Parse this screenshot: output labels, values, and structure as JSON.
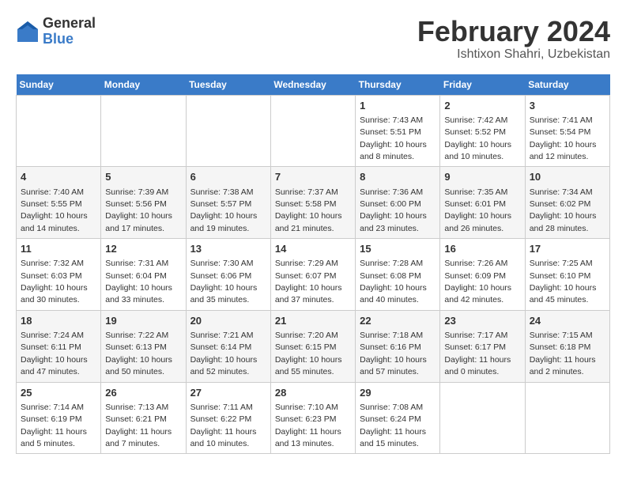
{
  "logo": {
    "general": "General",
    "blue": "Blue"
  },
  "header": {
    "title": "February 2024",
    "subtitle": "Ishtixon Shahri, Uzbekistan"
  },
  "weekdays": [
    "Sunday",
    "Monday",
    "Tuesday",
    "Wednesday",
    "Thursday",
    "Friday",
    "Saturday"
  ],
  "weeks": [
    [
      {
        "day": "",
        "detail": ""
      },
      {
        "day": "",
        "detail": ""
      },
      {
        "day": "",
        "detail": ""
      },
      {
        "day": "",
        "detail": ""
      },
      {
        "day": "1",
        "detail": "Sunrise: 7:43 AM\nSunset: 5:51 PM\nDaylight: 10 hours\nand 8 minutes."
      },
      {
        "day": "2",
        "detail": "Sunrise: 7:42 AM\nSunset: 5:52 PM\nDaylight: 10 hours\nand 10 minutes."
      },
      {
        "day": "3",
        "detail": "Sunrise: 7:41 AM\nSunset: 5:54 PM\nDaylight: 10 hours\nand 12 minutes."
      }
    ],
    [
      {
        "day": "4",
        "detail": "Sunrise: 7:40 AM\nSunset: 5:55 PM\nDaylight: 10 hours\nand 14 minutes."
      },
      {
        "day": "5",
        "detail": "Sunrise: 7:39 AM\nSunset: 5:56 PM\nDaylight: 10 hours\nand 17 minutes."
      },
      {
        "day": "6",
        "detail": "Sunrise: 7:38 AM\nSunset: 5:57 PM\nDaylight: 10 hours\nand 19 minutes."
      },
      {
        "day": "7",
        "detail": "Sunrise: 7:37 AM\nSunset: 5:58 PM\nDaylight: 10 hours\nand 21 minutes."
      },
      {
        "day": "8",
        "detail": "Sunrise: 7:36 AM\nSunset: 6:00 PM\nDaylight: 10 hours\nand 23 minutes."
      },
      {
        "day": "9",
        "detail": "Sunrise: 7:35 AM\nSunset: 6:01 PM\nDaylight: 10 hours\nand 26 minutes."
      },
      {
        "day": "10",
        "detail": "Sunrise: 7:34 AM\nSunset: 6:02 PM\nDaylight: 10 hours\nand 28 minutes."
      }
    ],
    [
      {
        "day": "11",
        "detail": "Sunrise: 7:32 AM\nSunset: 6:03 PM\nDaylight: 10 hours\nand 30 minutes."
      },
      {
        "day": "12",
        "detail": "Sunrise: 7:31 AM\nSunset: 6:04 PM\nDaylight: 10 hours\nand 33 minutes."
      },
      {
        "day": "13",
        "detail": "Sunrise: 7:30 AM\nSunset: 6:06 PM\nDaylight: 10 hours\nand 35 minutes."
      },
      {
        "day": "14",
        "detail": "Sunrise: 7:29 AM\nSunset: 6:07 PM\nDaylight: 10 hours\nand 37 minutes."
      },
      {
        "day": "15",
        "detail": "Sunrise: 7:28 AM\nSunset: 6:08 PM\nDaylight: 10 hours\nand 40 minutes."
      },
      {
        "day": "16",
        "detail": "Sunrise: 7:26 AM\nSunset: 6:09 PM\nDaylight: 10 hours\nand 42 minutes."
      },
      {
        "day": "17",
        "detail": "Sunrise: 7:25 AM\nSunset: 6:10 PM\nDaylight: 10 hours\nand 45 minutes."
      }
    ],
    [
      {
        "day": "18",
        "detail": "Sunrise: 7:24 AM\nSunset: 6:11 PM\nDaylight: 10 hours\nand 47 minutes."
      },
      {
        "day": "19",
        "detail": "Sunrise: 7:22 AM\nSunset: 6:13 PM\nDaylight: 10 hours\nand 50 minutes."
      },
      {
        "day": "20",
        "detail": "Sunrise: 7:21 AM\nSunset: 6:14 PM\nDaylight: 10 hours\nand 52 minutes."
      },
      {
        "day": "21",
        "detail": "Sunrise: 7:20 AM\nSunset: 6:15 PM\nDaylight: 10 hours\nand 55 minutes."
      },
      {
        "day": "22",
        "detail": "Sunrise: 7:18 AM\nSunset: 6:16 PM\nDaylight: 10 hours\nand 57 minutes."
      },
      {
        "day": "23",
        "detail": "Sunrise: 7:17 AM\nSunset: 6:17 PM\nDaylight: 11 hours\nand 0 minutes."
      },
      {
        "day": "24",
        "detail": "Sunrise: 7:15 AM\nSunset: 6:18 PM\nDaylight: 11 hours\nand 2 minutes."
      }
    ],
    [
      {
        "day": "25",
        "detail": "Sunrise: 7:14 AM\nSunset: 6:19 PM\nDaylight: 11 hours\nand 5 minutes."
      },
      {
        "day": "26",
        "detail": "Sunrise: 7:13 AM\nSunset: 6:21 PM\nDaylight: 11 hours\nand 7 minutes."
      },
      {
        "day": "27",
        "detail": "Sunrise: 7:11 AM\nSunset: 6:22 PM\nDaylight: 11 hours\nand 10 minutes."
      },
      {
        "day": "28",
        "detail": "Sunrise: 7:10 AM\nSunset: 6:23 PM\nDaylight: 11 hours\nand 13 minutes."
      },
      {
        "day": "29",
        "detail": "Sunrise: 7:08 AM\nSunset: 6:24 PM\nDaylight: 11 hours\nand 15 minutes."
      },
      {
        "day": "",
        "detail": ""
      },
      {
        "day": "",
        "detail": ""
      }
    ]
  ]
}
